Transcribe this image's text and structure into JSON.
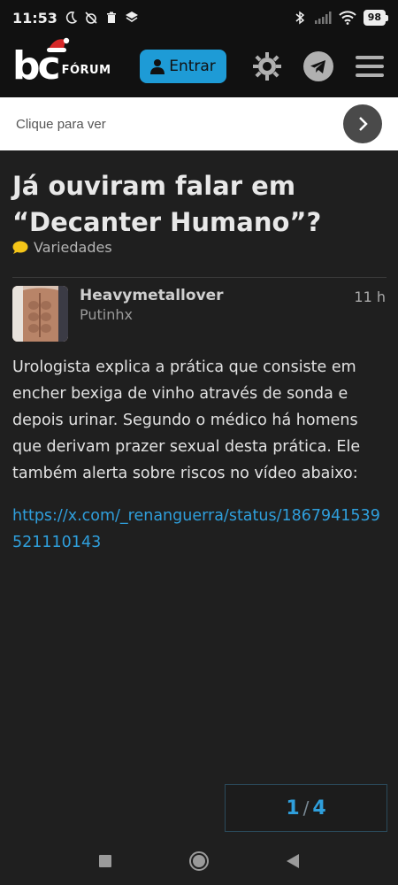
{
  "status_bar": {
    "time": "11:53",
    "battery": "98"
  },
  "header": {
    "logo_mark": "bc",
    "logo_text": "FÓRUM",
    "login_label": "Entrar"
  },
  "ad_banner": {
    "text": "Clique para ver"
  },
  "topic": {
    "title": "Já ouviram falar em “Decanter Humano”?",
    "category": "Variedades",
    "category_color": "#f5c518"
  },
  "post": {
    "author": "Heavymetallover",
    "subtitle": "Putinhx",
    "time": "11 h",
    "body": "Urologista explica a prática que consiste em encher bexiga de vinho através de sonda e depois urinar. Segundo o médico há homens que derivam prazer sexual desta prática. Ele também alerta sobre riscos no vídeo abaixo:",
    "link": "https://x.com/_renanguerra/status/1867941539521110143"
  },
  "pager": {
    "current": "1",
    "separator": "/",
    "total": "4"
  },
  "colors": {
    "accent": "#1e9bd6",
    "link": "#2f9fdc",
    "background": "#1f1f1f",
    "header": "#111111"
  },
  "icons": {
    "header": [
      "user-icon",
      "theme-sun-icon",
      "telegram-icon",
      "menu-icon"
    ],
    "nav": [
      "recents-square-icon",
      "home-circle-icon",
      "back-triangle-icon"
    ]
  }
}
